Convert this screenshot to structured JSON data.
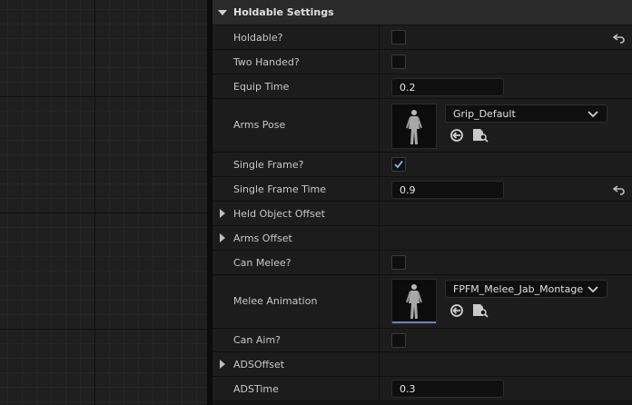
{
  "section": {
    "title": "Holdable Settings"
  },
  "rows": {
    "holdable": {
      "label": "Holdable?",
      "checked": false
    },
    "two_handed": {
      "label": "Two Handed?",
      "checked": false
    },
    "equip_time": {
      "label": "Equip Time",
      "value": "0.2"
    },
    "arms_pose": {
      "label": "Arms Pose",
      "asset": "Grip_Default"
    },
    "single_frame": {
      "label": "Single Frame?",
      "checked": true
    },
    "single_frame_time": {
      "label": "Single Frame Time",
      "value": "0.9"
    },
    "held_object_offset": {
      "label": "Held Object Offset"
    },
    "arms_offset": {
      "label": "Arms Offset"
    },
    "can_melee": {
      "label": "Can Melee?",
      "checked": false
    },
    "melee_animation": {
      "label": "Melee Animation",
      "asset": "FPFM_Melee_Jab_Montage"
    },
    "can_aim": {
      "label": "Can Aim?",
      "checked": false
    },
    "ads_offset": {
      "label": "ADSOffset"
    },
    "ads_time": {
      "label": "ADSTime",
      "value": "0.3"
    }
  },
  "icons": {
    "reset": "reset-to-default-icon",
    "use_selected": "use-selected-asset-icon",
    "browse": "browse-asset-icon",
    "dropdown": "chevron-down-icon",
    "check": "checkmark-icon",
    "expand": "expand-arrow-icon"
  },
  "colors": {
    "panel_bg": "#1c1c1c",
    "header_bg": "#2a2a2a",
    "thumb_accent": "#6f7fb6",
    "check": "#9fb7e6"
  }
}
